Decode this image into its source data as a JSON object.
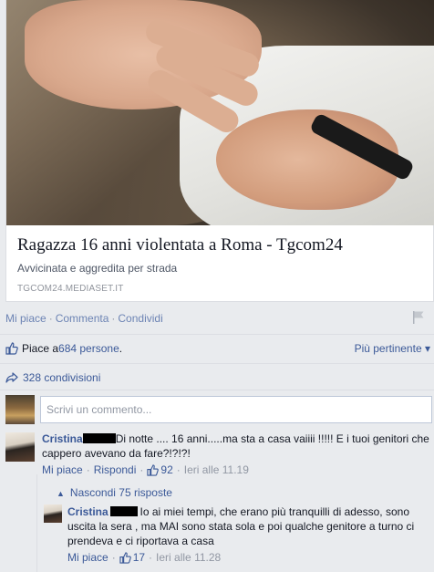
{
  "link_card": {
    "title": "Ragazza 16 anni violentata a Roma - Tgcom24",
    "description": "Avvicinata e aggredita per strada",
    "source": "TGCOM24.MEDIASET.IT"
  },
  "post_actions": {
    "like": "Mi piace",
    "comment": "Commenta",
    "share": "Condividi",
    "separator": "·"
  },
  "likes": {
    "prefix": "Piace a ",
    "count_link": "684 persone",
    "suffix": ".",
    "sort_label": "Più pertinente",
    "sort_arrow": "▾"
  },
  "shares": {
    "label": "328 condivisioni"
  },
  "comment_box": {
    "placeholder": "Scrivi un commento..."
  },
  "comments": [
    {
      "author": "Cristina",
      "text": "Di notte .... 16 anni.....ma sta a casa vaiiii !!!!! E i tuoi genitori che cappero avevano da fare?!?!?!",
      "like_label": "Mi piace",
      "reply_label": "Rispondi",
      "likes": "92",
      "time": "Ieri alle 11.19"
    }
  ],
  "replies_toggle": {
    "arrow": "▲",
    "label": "Nascondi 75 risposte"
  },
  "replies": [
    {
      "author": "Cristina",
      "text": "Io ai miei tempi, che erano più tranquilli di adesso, sono uscita la sera , ma MAI sono stata sola e poi qualche genitore a turno ci prendeva e ci riportava a casa",
      "like_label": "Mi piace",
      "likes": "17",
      "time": "Ieri alle 11.28"
    }
  ],
  "colors": {
    "link": "#3b5998",
    "muted": "#9197a3",
    "background": "#e9ebee"
  }
}
